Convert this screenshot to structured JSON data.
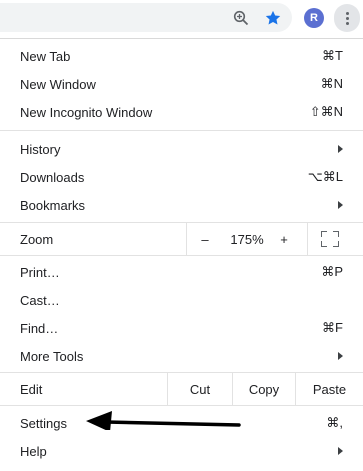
{
  "toolbar": {
    "zoom_icon": "zoom-in-magnifier-icon",
    "star_icon": "bookmark-star-icon",
    "avatar_letter": "R",
    "menu_icon": "three-dot-menu-icon"
  },
  "menu": {
    "new_tab": {
      "label": "New Tab",
      "shortcut": "⌘T"
    },
    "new_window": {
      "label": "New Window",
      "shortcut": "⌘N"
    },
    "new_incognito": {
      "label": "New Incognito Window",
      "shortcut": "⇧⌘N"
    },
    "history": {
      "label": "History"
    },
    "downloads": {
      "label": "Downloads",
      "shortcut": "⌥⌘L"
    },
    "bookmarks": {
      "label": "Bookmarks"
    },
    "zoom": {
      "label": "Zoom",
      "minus": "–",
      "value": "175%",
      "plus": "+",
      "fullscreen_icon": "fullscreen-icon"
    },
    "print": {
      "label": "Print…",
      "shortcut": "⌘P"
    },
    "cast": {
      "label": "Cast…"
    },
    "find": {
      "label": "Find…",
      "shortcut": "⌘F"
    },
    "more_tools": {
      "label": "More Tools"
    },
    "edit": {
      "label": "Edit",
      "cut": "Cut",
      "copy": "Copy",
      "paste": "Paste"
    },
    "settings": {
      "label": "Settings",
      "shortcut": "⌘,"
    },
    "help": {
      "label": "Help"
    }
  },
  "colors": {
    "accent": "#1a73e8",
    "avatar": "#5b6fd1",
    "arrow": "#000000"
  }
}
